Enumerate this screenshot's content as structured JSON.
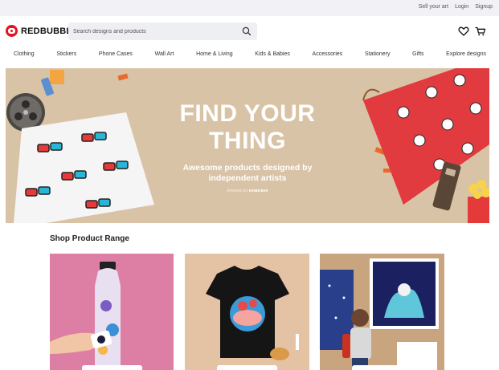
{
  "topbar": {
    "links": [
      "Sell your art",
      "Login",
      "Signup"
    ]
  },
  "header": {
    "brand": "REDBUBBLE",
    "search_placeholder": "Search designs and products"
  },
  "nav": {
    "items": [
      "Clothing",
      "Stickers",
      "Phone Cases",
      "Wall Art",
      "Home & Living",
      "Kids & Babies",
      "Accessories",
      "Stationery",
      "Gifts",
      "Explore designs"
    ]
  },
  "hero": {
    "title_line1": "FIND YOUR",
    "title_line2": "THING",
    "subtitle_line1": "Awesome products designed by",
    "subtitle_line2": "independent artists",
    "credit_prefix": "Artwork by",
    "credit_artist": "evanrave"
  },
  "products": {
    "title": "Shop Product Range",
    "cards": [
      {
        "image": "sticker-water-bottle-photo"
      },
      {
        "image": "tshirt-photo"
      },
      {
        "image": "art-prints-photo"
      }
    ]
  },
  "colors": {
    "brand_red": "#e41321",
    "hero_bg": "#d9c3a6"
  }
}
